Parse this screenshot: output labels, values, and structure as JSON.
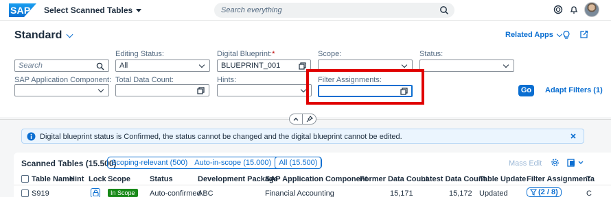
{
  "shell": {
    "logo": "SAP",
    "app_title": "Select Scanned Tables",
    "search_placeholder": "Search everything"
  },
  "header": {
    "variant": "Standard",
    "related_apps": "Related Apps"
  },
  "filters": {
    "search_placeholder": "Search",
    "editing_status": {
      "label": "Editing Status:",
      "value": "All"
    },
    "digital_blueprint": {
      "label": "Digital Blueprint:",
      "required": "*",
      "value": "BLUEPRINT_001"
    },
    "scope": {
      "label": "Scope:",
      "value": ""
    },
    "status": {
      "label": "Status:",
      "value": ""
    },
    "sap_app_component": {
      "label": "SAP Application Component:",
      "value": ""
    },
    "total_data_count": {
      "label": "Total Data Count:",
      "value": ""
    },
    "hints": {
      "label": "Hints:",
      "value": ""
    },
    "filter_assignments": {
      "label": "Filter Assignments:",
      "value": ""
    },
    "go": "Go",
    "adapt_filters": "Adapt Filters (1)"
  },
  "message": {
    "text": "Digital blueprint status is Confirmed, the status cannot be changed and the digital blueprint cannot be edited."
  },
  "table": {
    "title": "Scanned Tables (15.500)",
    "segments": [
      "Scoping-relevant (500)",
      "Auto-in-scope (15.000)",
      "All (15.500)"
    ],
    "mass_edit": "Mass Edit",
    "columns": [
      "Table Name",
      "Hint",
      "Lock",
      "Scope",
      "Status",
      "Development Package",
      "SAP Application Component",
      "Former Data Count",
      "Latest Data Count",
      "Table Update",
      "Filter Assignment",
      "Ta"
    ],
    "rows": [
      {
        "table_name": "S919",
        "scope": "In Scope",
        "status": "Auto-confirmed",
        "dev_package": "ABC",
        "app_component": "Financial Accounting",
        "former_count": "15,171",
        "latest_count": "15,172",
        "table_update": "Updated",
        "filter_assignment": "(2 / 8)",
        "ta": "C"
      }
    ]
  },
  "colors": {
    "accent": "#0a6ed1",
    "positive": "#188918",
    "highlight": "#e00000"
  }
}
